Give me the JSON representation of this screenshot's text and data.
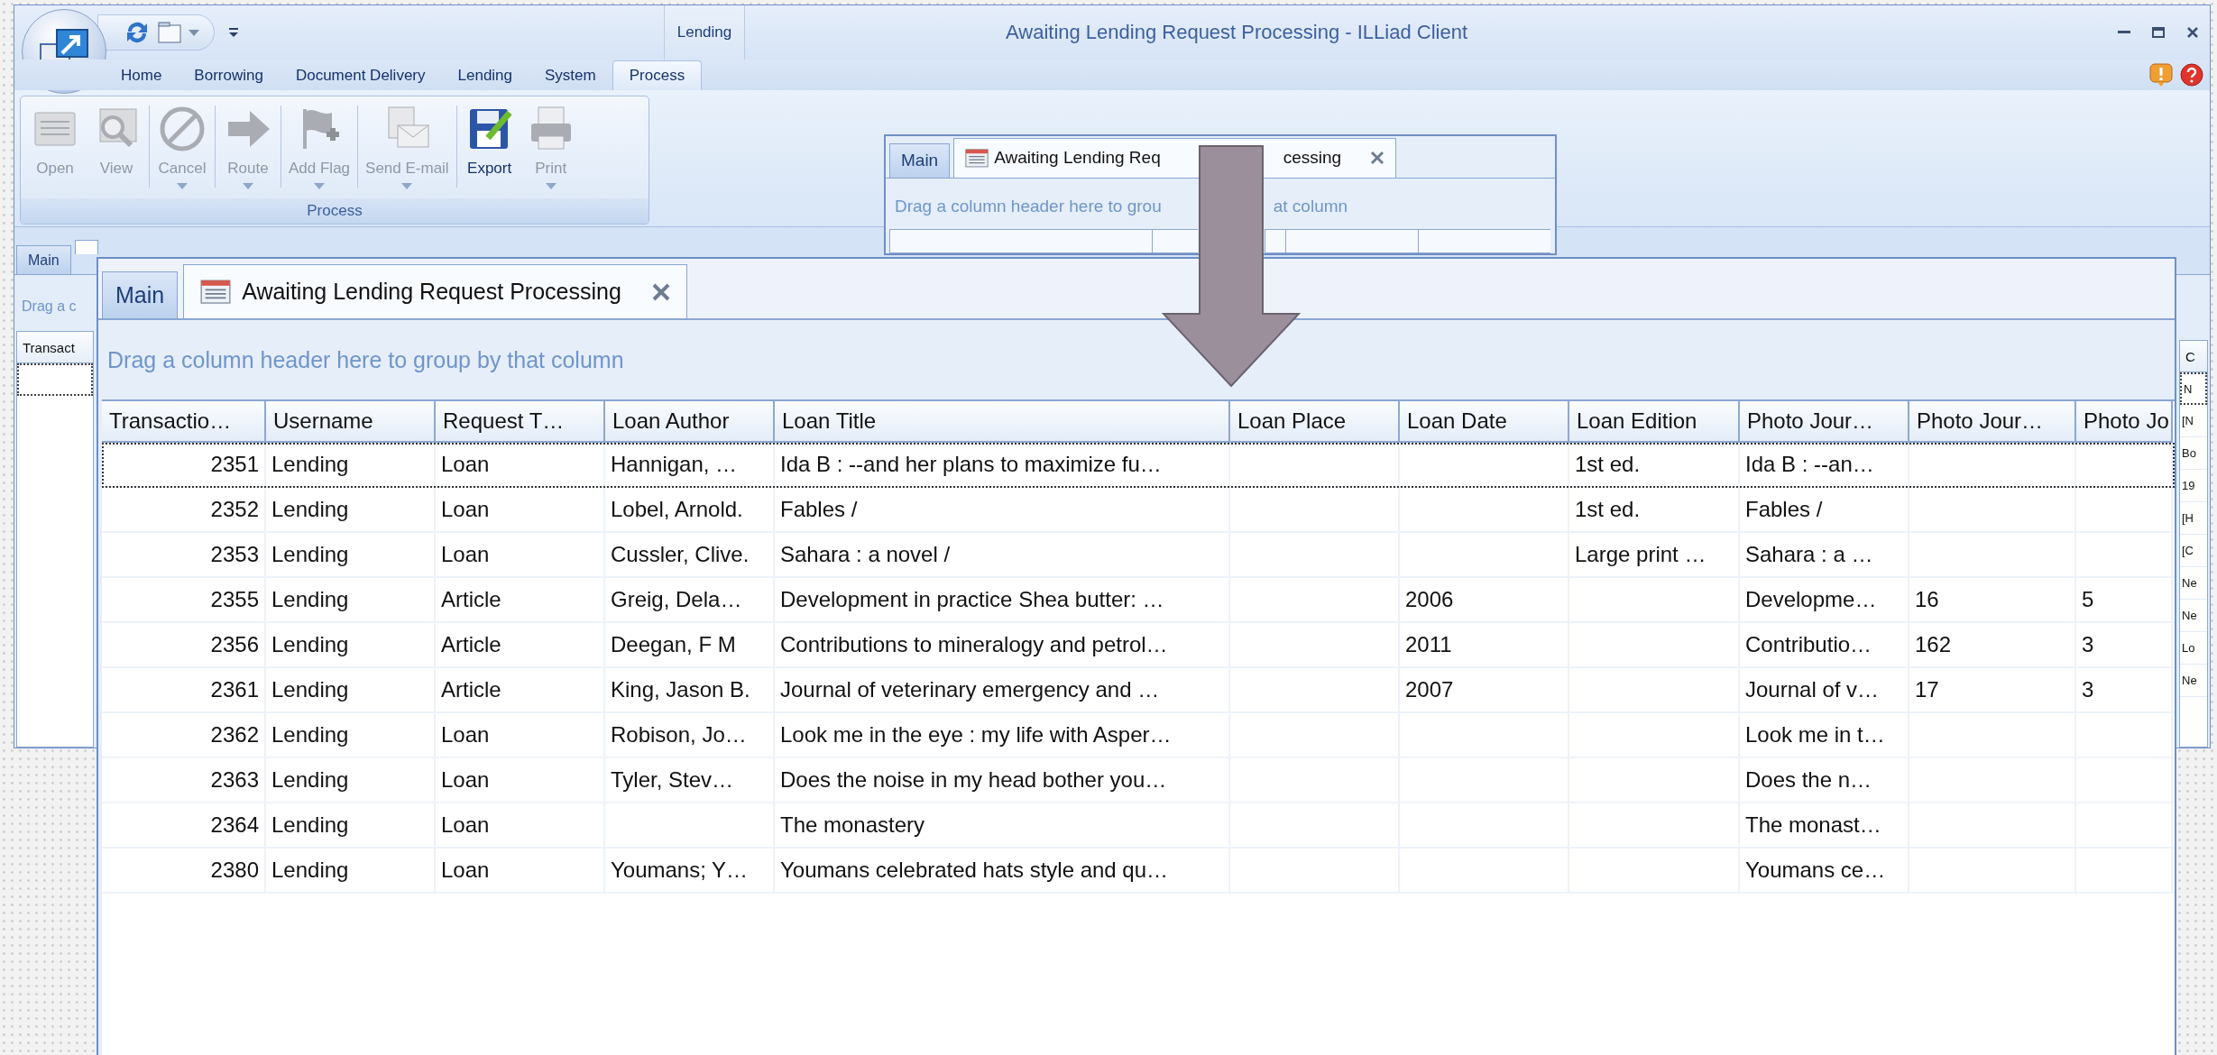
{
  "window": {
    "title": "Awaiting Lending Request Processing - ILLiad Client",
    "contextual_group": "Lending"
  },
  "ribbon": {
    "tabs": [
      {
        "label": "Home",
        "selected": false
      },
      {
        "label": "Borrowing",
        "selected": false
      },
      {
        "label": "Document Delivery",
        "selected": false
      },
      {
        "label": "Lending",
        "selected": false
      },
      {
        "label": "System",
        "selected": false
      },
      {
        "label": "Process",
        "selected": true
      }
    ],
    "group": {
      "label": "Process",
      "buttons": [
        {
          "label": "Open",
          "kind": "open",
          "disabled": true,
          "dropdown": false
        },
        {
          "label": "View",
          "kind": "view",
          "disabled": true,
          "dropdown": false
        },
        {
          "label": "Cancel",
          "kind": "cancel",
          "disabled": true,
          "dropdown": true
        },
        {
          "label": "Route",
          "kind": "route",
          "disabled": true,
          "dropdown": true
        },
        {
          "label": "Add Flag",
          "kind": "flag",
          "disabled": true,
          "dropdown": true
        },
        {
          "label": "Send E-mail",
          "kind": "email",
          "disabled": true,
          "dropdown": true
        },
        {
          "label": "Export",
          "kind": "export",
          "disabled": false,
          "dropdown": false
        },
        {
          "label": "Print",
          "kind": "print",
          "disabled": true,
          "dropdown": true
        }
      ]
    }
  },
  "background": {
    "tabs": [
      {
        "label": "Main",
        "selected": false
      }
    ],
    "group_hint": "Drag a c",
    "column_header": "Transact",
    "right_column": {
      "header": "C",
      "cells": [
        "N",
        "[N",
        "Bo",
        "19",
        "[H",
        "[C",
        "Ne",
        "Ne",
        "Lo",
        "Ne"
      ]
    }
  },
  "inset": {
    "tabs": [
      {
        "label_parts": [
          "Main"
        ],
        "selected": false
      },
      {
        "label_parts": [
          "Awaiting Lending Req",
          "cessing"
        ],
        "selected": true
      }
    ],
    "group_hint_parts": [
      "Drag a column header here to grou",
      "at column"
    ]
  },
  "panel": {
    "tabs": [
      {
        "label": "Main",
        "kind": "main",
        "selected": false
      },
      {
        "label": "Awaiting Lending Request Processing",
        "kind": "document",
        "selected": true
      }
    ],
    "group_hint": "Drag a column header here to group by that column",
    "columns": [
      "Transactio…",
      "Username",
      "Request T…",
      "Loan Author",
      "Loan Title",
      "Loan Place",
      "Loan Date",
      "Loan Edition",
      "Photo Jour…",
      "Photo Jour…",
      "Photo Jo"
    ],
    "rows": [
      {
        "focused": true,
        "cells": [
          "2351",
          "Lending",
          "Loan",
          "Hannigan, …",
          "Ida B : --and her plans to maximize fu…",
          null,
          null,
          "1st ed.",
          "Ida B : --an…",
          null,
          null
        ]
      },
      {
        "focused": false,
        "cells": [
          "2352",
          "Lending",
          "Loan",
          "Lobel, Arnold.",
          "Fables /",
          null,
          null,
          "1st ed.",
          "Fables /",
          null,
          null
        ]
      },
      {
        "focused": false,
        "cells": [
          "2353",
          "Lending",
          "Loan",
          "Cussler, Clive.",
          "Sahara : a novel /",
          null,
          null,
          "Large print …",
          "Sahara : a …",
          null,
          null
        ]
      },
      {
        "focused": false,
        "cells": [
          "2355",
          "Lending",
          "Article",
          "Greig, Dela…",
          "Development in practice Shea butter: …",
          null,
          "2006",
          null,
          "Developme…",
          "16",
          "5"
        ]
      },
      {
        "focused": false,
        "cells": [
          "2356",
          "Lending",
          "Article",
          "Deegan, F M",
          "Contributions to mineralogy and petrol…",
          null,
          "2011",
          null,
          "Contributio…",
          "162",
          "3"
        ]
      },
      {
        "focused": false,
        "cells": [
          "2361",
          "Lending",
          "Article",
          "King, Jason B.",
          "Journal of veterinary emergency and …",
          null,
          "2007",
          null,
          "Journal of v…",
          "17",
          "3"
        ]
      },
      {
        "focused": false,
        "cells": [
          "2362",
          "Lending",
          "Loan",
          "Robison, Jo…",
          "Look me in the eye : my life with Asper…",
          null,
          null,
          null,
          "Look me in t…",
          null,
          null
        ]
      },
      {
        "focused": false,
        "cells": [
          "2363",
          "Lending",
          "Loan",
          "Tyler, Stev…",
          "Does the noise in my head bother you…",
          null,
          null,
          null,
          "Does the n…",
          null,
          null
        ]
      },
      {
        "focused": false,
        "cells": [
          "2364",
          "Lending",
          "Loan",
          null,
          "The monastery",
          null,
          null,
          null,
          "The monast…",
          null,
          null
        ]
      },
      {
        "focused": false,
        "cells": [
          "2380",
          "Lending",
          "Loan",
          "Youmans; Y…",
          "Youmans celebrated hats style and qu…",
          null,
          null,
          null,
          "Youmans ce…",
          null,
          null
        ]
      }
    ]
  }
}
